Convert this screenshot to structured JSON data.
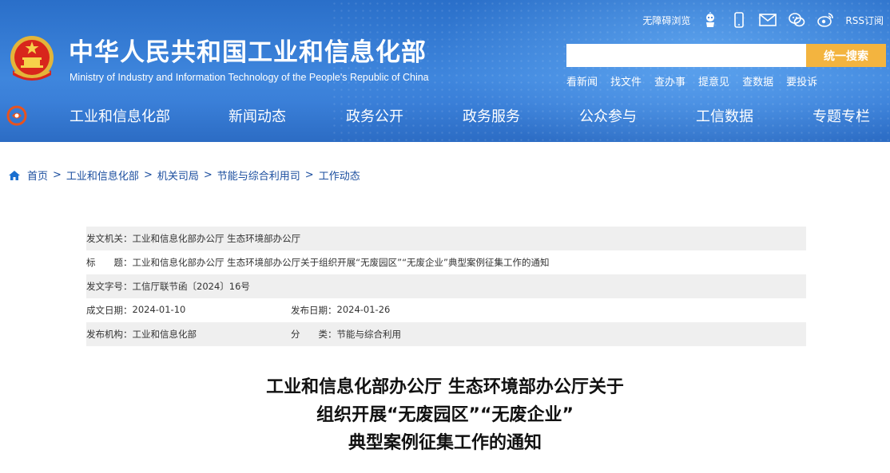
{
  "header": {
    "site_title": "中华人民共和国工业和信息化部",
    "site_subtitle": "Ministry of Industry and Information Technology of the People's Republic of China",
    "utility": {
      "accessibility_label": "无障碍浏览",
      "icons": [
        "robot-assistant-icon",
        "mobile-icon",
        "mail-icon",
        "wechat-icon",
        "weibo-icon"
      ],
      "rss_label": "RSS订阅"
    },
    "search": {
      "value": "",
      "placeholder": "",
      "button_label": "统一搜索"
    },
    "quick_links": [
      "看新闻",
      "找文件",
      "查办事",
      "提意见",
      "查数据",
      "要投诉"
    ]
  },
  "nav": {
    "items": [
      "工业和信息化部",
      "新闻动态",
      "政务公开",
      "政务服务",
      "公众参与",
      "工信数据",
      "专题专栏"
    ]
  },
  "breadcrumb": {
    "items": [
      "首页",
      "工业和信息化部",
      "机关司局",
      "节能与综合利用司",
      "工作动态"
    ],
    "separator": ">"
  },
  "info": {
    "issuer_label": "发文机关：",
    "issuer": "工业和信息化部办公厅 生态环境部办公厅",
    "title_label": "标　　题：",
    "title": "工业和信息化部办公厅 生态环境部办公厅关于组织开展“无废园区”“无废企业”典型案例征集工作的通知",
    "doc_no_label": "发文字号：",
    "doc_no": "工信厅联节函〔2024〕16号",
    "created_label": "成文日期：",
    "created": "2024-01-10",
    "published_label": "发布日期：",
    "published": "2024-01-26",
    "org_label": "发布机构：",
    "org": "工业和信息化部",
    "category_label": "分　　类：",
    "category": "节能与综合利用"
  },
  "document": {
    "title_lines": [
      "工业和信息化部办公厅 生态环境部办公厅关于",
      "组织开展“无废园区”“无废企业”",
      "典型案例征集工作的通知"
    ]
  },
  "colors": {
    "header_blue": "#3f86dd",
    "search_button": "#f3b43f",
    "link_blue": "#1a4d9e",
    "row_shade": "#efefef"
  }
}
